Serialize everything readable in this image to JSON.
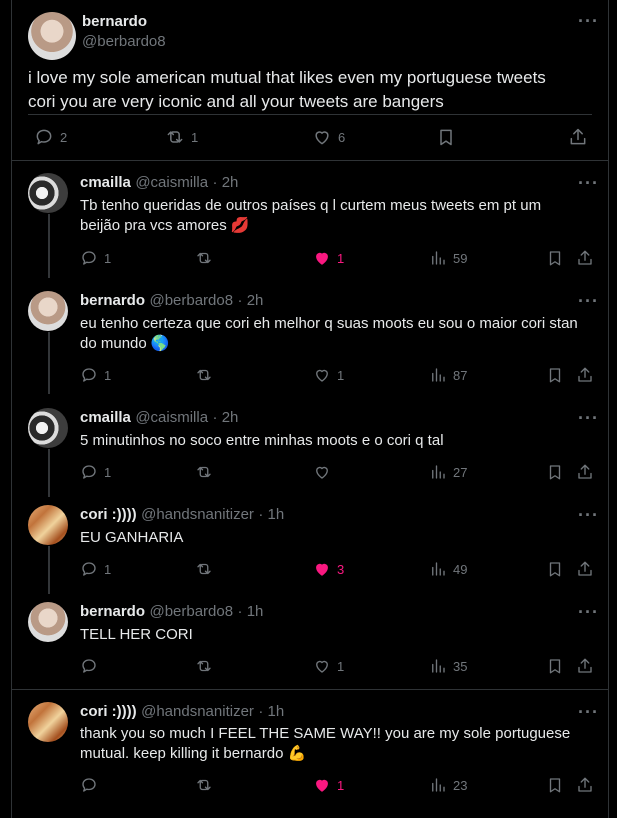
{
  "main_tweet": {
    "name": "bernardo",
    "handle": "@berbardo8",
    "text_line1": "i love my sole american mutual that likes even my portuguese tweets",
    "text_line2": "cori you are very iconic and all your tweets are bangers",
    "replies": "2",
    "retweets": "1",
    "likes": "6"
  },
  "replies": [
    {
      "name": "cmailla",
      "handle": "@caismilla",
      "time": "· 2h",
      "line1": "Tb tenho queridas de outros países q l curtem meus tweets em pt um",
      "line2": "beijão pra vcs amores 💋",
      "reply_count": "1",
      "like_count": "1",
      "views": "59",
      "liked": true
    },
    {
      "name": "bernardo",
      "handle": "@berbardo8",
      "time": "· 2h",
      "line1": "eu tenho certeza que cori eh melhor q suas moots eu sou o maior cori stan",
      "line2": "do mundo 🌎",
      "reply_count": "1",
      "like_count": "1",
      "views": "87",
      "liked": false
    },
    {
      "name": "cmailla",
      "handle": "@caismilla",
      "time": "· 2h",
      "line1": "5 minutinhos no soco entre minhas moots e o cori q tal",
      "line2": "",
      "reply_count": "1",
      "like_count": "",
      "views": "27",
      "liked": false
    },
    {
      "name": "cori :))))",
      "handle": "@handsnanitizer",
      "time": "· 1h",
      "line1": "EU GANHARIA",
      "line2": "",
      "reply_count": "1",
      "like_count": "3",
      "views": "49",
      "liked": true
    },
    {
      "name": "bernardo",
      "handle": "@berbardo8",
      "time": "· 1h",
      "line1": "TELL HER CORI",
      "line2": "",
      "reply_count": "",
      "like_count": "1",
      "views": "35",
      "liked": false
    },
    {
      "name": "cori :))))",
      "handle": "@handsnanitizer",
      "time": "· 1h",
      "line1": "thank you so much I FEEL THE SAME WAY!! you are my sole portuguese",
      "line2": "mutual. keep killing it bernardo 💪",
      "reply_count": "",
      "like_count": "1",
      "views": "23",
      "liked": true
    }
  ],
  "icons": {
    "reply": "reply-icon",
    "retweet": "retweet-icon",
    "like": "heart-icon",
    "views": "views-icon",
    "bookmark": "bookmark-icon",
    "share": "share-icon",
    "more": "more-icon"
  },
  "colors": {
    "like": "#f91880",
    "muted": "#71767b",
    "text": "#e7e9ea",
    "border": "#2f3336"
  }
}
